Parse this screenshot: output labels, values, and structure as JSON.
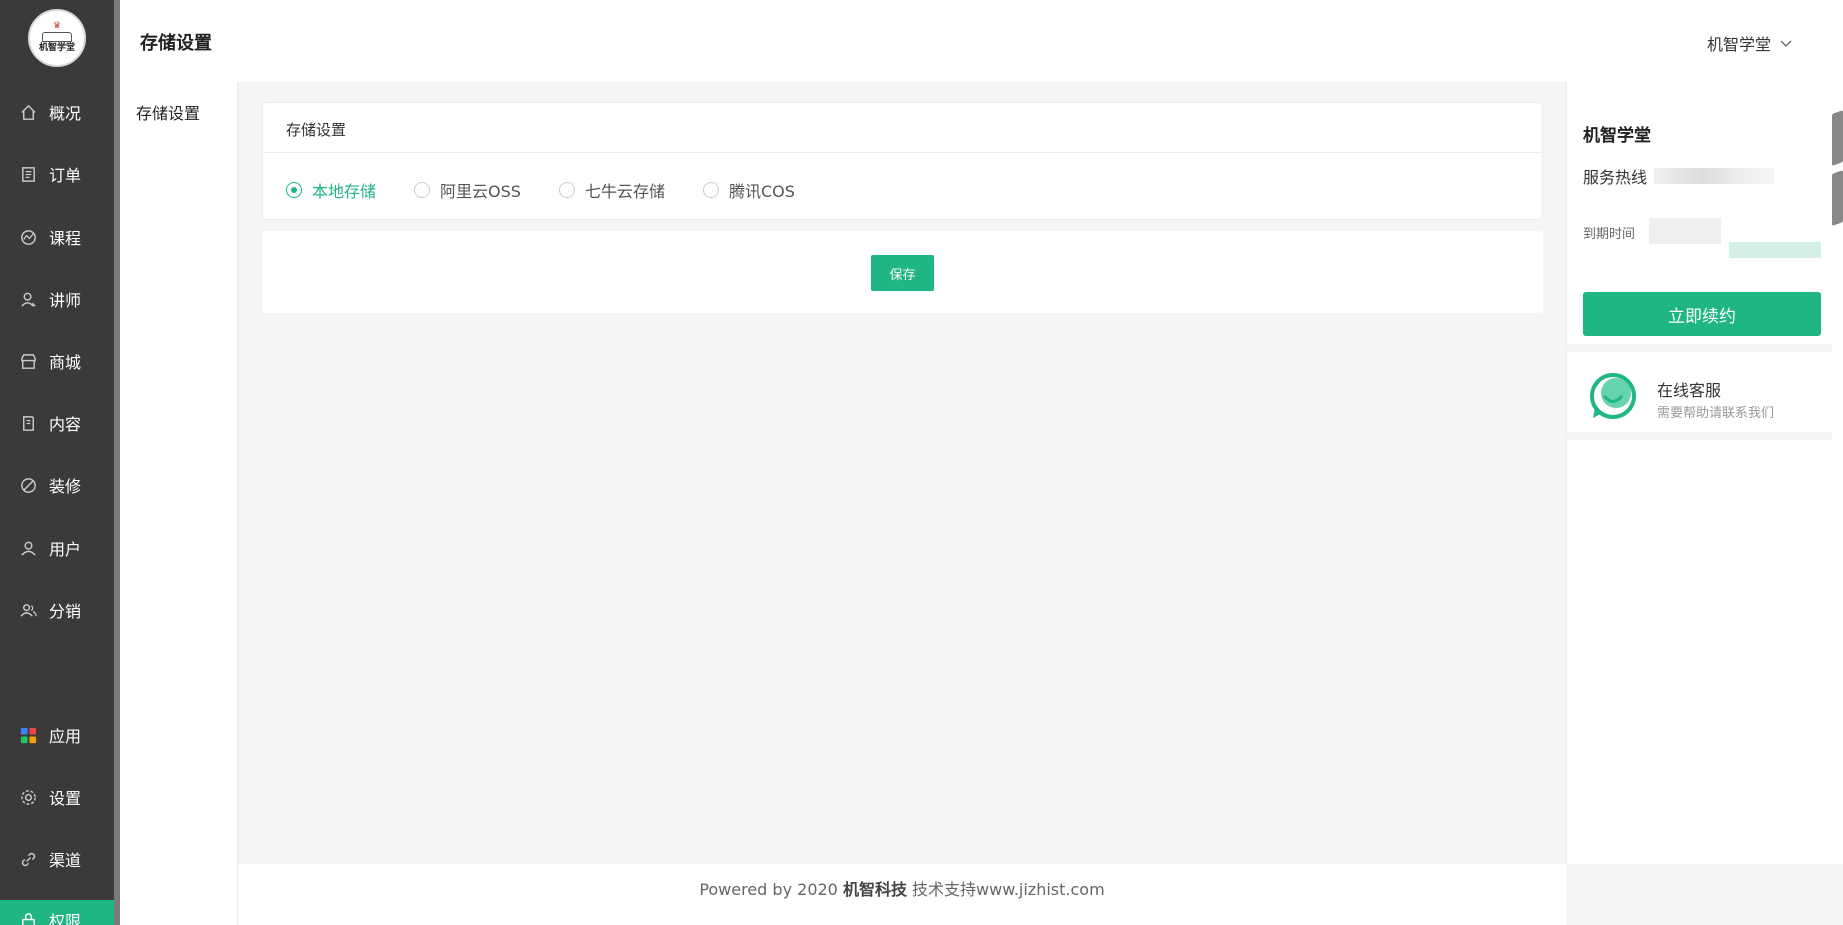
{
  "brand": {
    "logo_text": "机智学堂",
    "accent": "#1fb584"
  },
  "nav": [
    {
      "id": "overview",
      "label": "概况",
      "icon": "home-icon"
    },
    {
      "id": "orders",
      "label": "订单",
      "icon": "receipt-icon"
    },
    {
      "id": "courses",
      "label": "课程",
      "icon": "chart-icon"
    },
    {
      "id": "teachers",
      "label": "讲师",
      "icon": "teacher-icon"
    },
    {
      "id": "mall",
      "label": "商城",
      "icon": "store-icon"
    },
    {
      "id": "content",
      "label": "内容",
      "icon": "document-icon"
    },
    {
      "id": "decorate",
      "label": "装修",
      "icon": "brush-icon"
    },
    {
      "id": "users",
      "label": "用户",
      "icon": "user-icon"
    },
    {
      "id": "distribution",
      "label": "分销",
      "icon": "users-icon"
    },
    {
      "id": "apps",
      "label": "应用",
      "icon": "apps-icon"
    },
    {
      "id": "settings",
      "label": "设置",
      "icon": "gear-icon"
    },
    {
      "id": "channels",
      "label": "渠道",
      "icon": "link-icon"
    },
    {
      "id": "permissions",
      "label": "权限",
      "icon": "lock-icon",
      "active": true
    }
  ],
  "subnav": {
    "item": "存储设置"
  },
  "header": {
    "title": "存储设置",
    "user": "机智学堂"
  },
  "storage": {
    "card_title": "存储设置",
    "options": [
      "本地存储",
      "阿里云OSS",
      "七牛云存储",
      "腾讯COS"
    ],
    "selected": "本地存储",
    "save_label": "保存"
  },
  "account": {
    "name": "机智学堂",
    "hotline_label": "服务热线",
    "expire_label": "到期时间",
    "renew_label": "立即续约"
  },
  "support": {
    "title": "在线客服",
    "subtitle": "需要帮助请联系我们"
  },
  "footer": {
    "prefix": "Powered by 2020 ",
    "company": "机智科技",
    "suffix": " 技术支持www.jizhist.com"
  }
}
